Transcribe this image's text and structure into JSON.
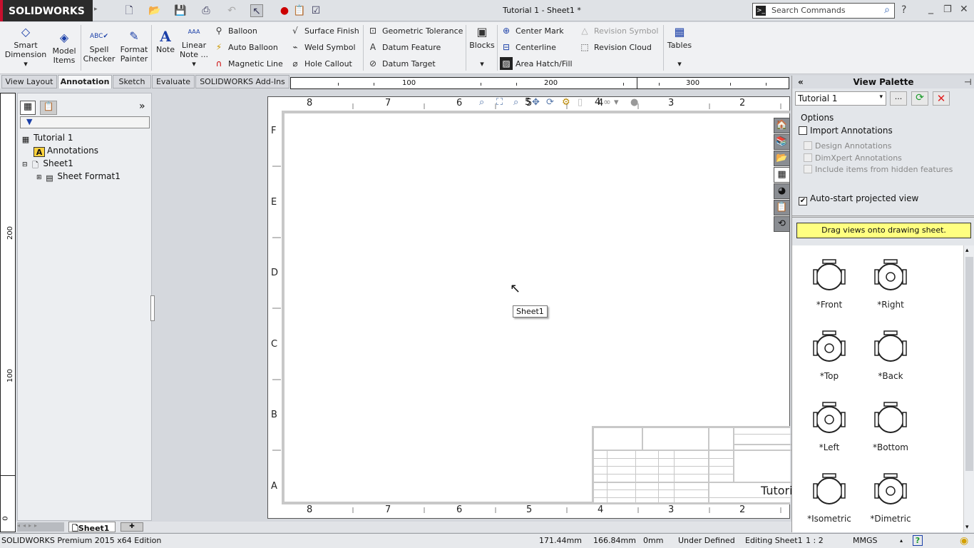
{
  "app": {
    "brand": "SOLIDWORKS",
    "title": "Tutorial 1 - Sheet1 *",
    "search_placeholder": "Search Commands"
  },
  "ribbon": {
    "large": [
      {
        "label": "Smart Dimension",
        "icon": "smart-dimension-icon"
      },
      {
        "label": "Model Items",
        "icon": "model-items-icon"
      },
      {
        "label": "Spell Checker",
        "icon": "spell-checker-icon"
      },
      {
        "label": "Format Painter",
        "icon": "format-painter-icon"
      },
      {
        "label": "Note",
        "icon": "note-icon"
      },
      {
        "label": "Linear Note ...",
        "icon": "linear-note-icon"
      },
      {
        "label": "Blocks",
        "icon": "blocks-icon"
      },
      {
        "label": "Tables",
        "icon": "tables-icon"
      }
    ],
    "small": [
      {
        "label": "Balloon"
      },
      {
        "label": "Auto Balloon"
      },
      {
        "label": "Magnetic Line"
      },
      {
        "label": "Surface Finish"
      },
      {
        "label": "Weld Symbol"
      },
      {
        "label": "Hole Callout"
      },
      {
        "label": "Geometric Tolerance"
      },
      {
        "label": "Datum Feature"
      },
      {
        "label": "Datum Target"
      },
      {
        "label": "Center Mark"
      },
      {
        "label": "Centerline"
      },
      {
        "label": "Area Hatch/Fill"
      },
      {
        "label": "Revision Symbol",
        "disabled": true
      },
      {
        "label": "Revision Cloud"
      }
    ]
  },
  "tabs": [
    {
      "label": "View Layout"
    },
    {
      "label": "Annotation",
      "active": true
    },
    {
      "label": "Sketch"
    },
    {
      "label": "Evaluate"
    },
    {
      "label": "SOLIDWORKS Add-Ins"
    }
  ],
  "rulers": {
    "horizontal": [
      "100",
      "200",
      "300"
    ],
    "vertical": [
      "200",
      "100",
      "0"
    ]
  },
  "tree": [
    {
      "label": "Tutorial 1"
    },
    {
      "label": "Annotations"
    },
    {
      "label": "Sheet1"
    },
    {
      "label": "Sheet Format1"
    }
  ],
  "sheet": {
    "columns": [
      "8",
      "7",
      "6",
      "5",
      "4",
      "3",
      "2"
    ],
    "rows": [
      "F",
      "E",
      "D",
      "C",
      "B",
      "A"
    ],
    "title_fragment": "Tutori",
    "tooltip": "Sheet1",
    "hud_digits": [
      "5",
      "4"
    ]
  },
  "view_palette": {
    "title": "View Palette",
    "document": "Tutorial 1",
    "browse": "...",
    "options_label": "Options",
    "import_annotations": {
      "label": "Import Annotations",
      "checked": false
    },
    "sub_options": [
      {
        "label": "Design Annotations"
      },
      {
        "label": "DimXpert Annotations"
      },
      {
        "label": "Include items from hidden features"
      }
    ],
    "auto_start": {
      "label": "Auto-start projected view",
      "checked": true
    },
    "banner": "Drag views onto drawing sheet.",
    "views": [
      {
        "label": "*Front"
      },
      {
        "label": "*Right"
      },
      {
        "label": "*Top"
      },
      {
        "label": "*Back"
      },
      {
        "label": "*Left"
      },
      {
        "label": "*Bottom"
      },
      {
        "label": "*Isometric"
      },
      {
        "label": "*Dimetric"
      }
    ]
  },
  "sheet_tabs": [
    {
      "label": "Sheet1"
    }
  ],
  "status": {
    "edition": "SOLIDWORKS Premium 2015 x64 Edition",
    "x": "171.44mm",
    "y": "166.84mm",
    "z": "0mm",
    "state": "Under Defined",
    "editing": "Editing Sheet1",
    "scale": "1 : 2",
    "units": "MMGS"
  }
}
